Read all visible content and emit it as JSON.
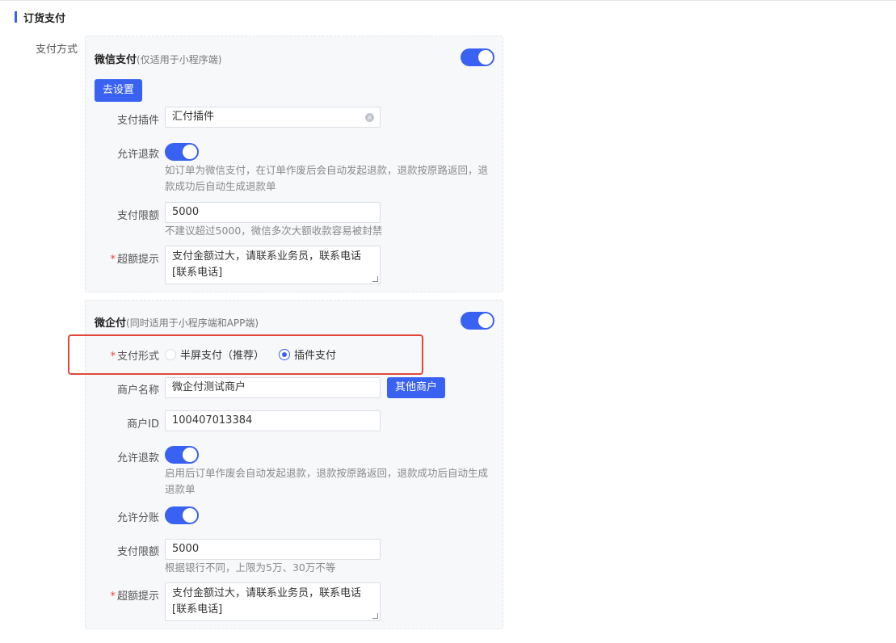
{
  "section_title": "订货支付",
  "pay_method_label": "支付方式",
  "wechat": {
    "title": "微信支付",
    "subtitle": "(仅适用于小程序端)",
    "setup_button": "去设置",
    "plugin_label": "支付插件",
    "plugin_value": "汇付插件",
    "refund_label": "允许退款",
    "refund_hint": "如订单为微信支付，在订单作废后会自动发起退款，退款按原路返回，退款成功后自动生成退款单",
    "limit_label": "支付限额",
    "limit_value": "5000",
    "limit_hint": "不建议超过5000，微信多次大额收款容易被封禁",
    "over_label": "超额提示",
    "over_value": "支付金额过大，请联系业务员，联系电话[联系电话]"
  },
  "wecom": {
    "title": "微企付",
    "subtitle": "(同时适用于小程序端和APP端)",
    "form_label": "支付形式",
    "radio_options": [
      "半屏支付（推荐）",
      "插件支付"
    ],
    "selected_option": "插件支付",
    "merchant_name_label": "商户名称",
    "merchant_name_value": "微企付测试商户",
    "other_merchant_button": "其他商户",
    "merchant_id_label": "商户ID",
    "merchant_id_value": "100407013384",
    "refund_label": "允许退款",
    "refund_hint": "启用后订单作废会自动发起退款，退款按原路返回，退款成功后自动生成退款单",
    "split_label": "允许分账",
    "limit_label": "支付限额",
    "limit_value": "5000",
    "limit_hint": "根据银行不同，上限为5万、30万不等",
    "over_label": "超额提示",
    "over_value": "支付金额过大，请联系业务员，联系电话[联系电话]"
  },
  "colors": {
    "accent": "#3a62f2",
    "highlight": "#e0463a",
    "required": "#f03d3d"
  }
}
